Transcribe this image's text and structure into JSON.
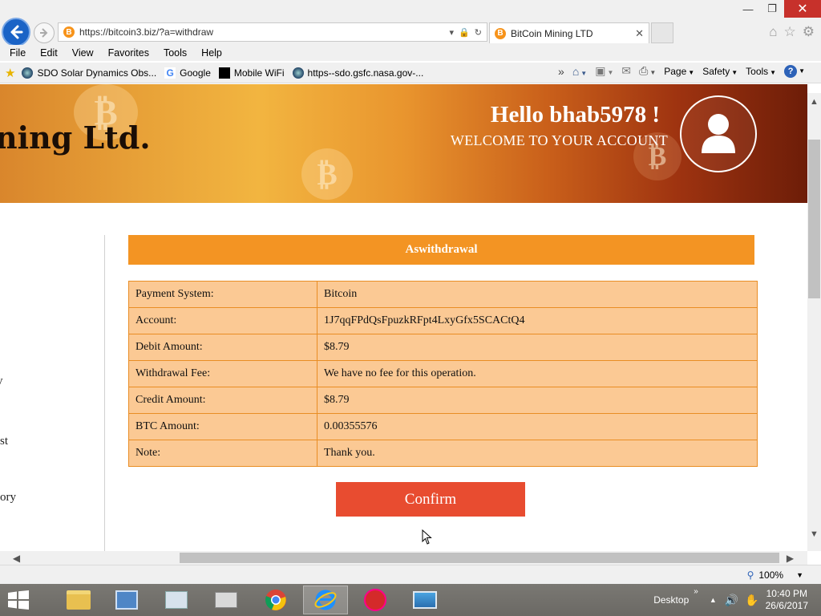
{
  "browser": {
    "url": "https://bitcoin3.biz/?a=withdraw",
    "url_host": "bitcoin3.biz",
    "tab_title": "BitCoin Mining LTD",
    "menu": [
      "File",
      "Edit",
      "View",
      "Favorites",
      "Tools",
      "Help"
    ],
    "favorites": [
      {
        "label": "SDO  Solar Dynamics Obs...",
        "icon": "sdo-icon"
      },
      {
        "label": "Google",
        "icon": "google-icon"
      },
      {
        "label": "Mobile WiFi",
        "icon": "mobile-wifi-icon"
      },
      {
        "label": "https--sdo.gsfc.nasa.gov-...",
        "icon": "sdo-icon"
      }
    ],
    "commands": {
      "page": "Page",
      "safety": "Safety",
      "tools": "Tools"
    },
    "zoom": "100%"
  },
  "header": {
    "brand_fragment": "ning Ltd.",
    "greeting": "Hello bhab5978 !",
    "welcome": "WELCOME TO YOUR ACCOUNT"
  },
  "sidebar_fragments": [
    "y",
    "st",
    "ory"
  ],
  "withdraw": {
    "title": "Aswithdrawal",
    "rows": [
      {
        "label": "Payment System:",
        "value": "Bitcoin"
      },
      {
        "label": "Account:",
        "value": "1J7qqFPdQsFpuzkRFpt4LxyGfx5SCACtQ4"
      },
      {
        "label": "Debit Amount:",
        "value": "$8.79"
      },
      {
        "label": "Withdrawal Fee:",
        "value": "We have no fee for this operation."
      },
      {
        "label": "Credit Amount:",
        "value": "$8.79"
      },
      {
        "label": "BTC Amount:",
        "value": "0.00355576"
      },
      {
        "label": "Note:",
        "value": "Thank you."
      }
    ],
    "confirm_label": "Confirm"
  },
  "taskbar": {
    "desktop_label": "Desktop",
    "time": "10:40 PM",
    "date": "26/6/2017"
  },
  "colors": {
    "accent_orange": "#f39423",
    "table_fill": "#fbc994",
    "confirm_red": "#e84c30"
  }
}
